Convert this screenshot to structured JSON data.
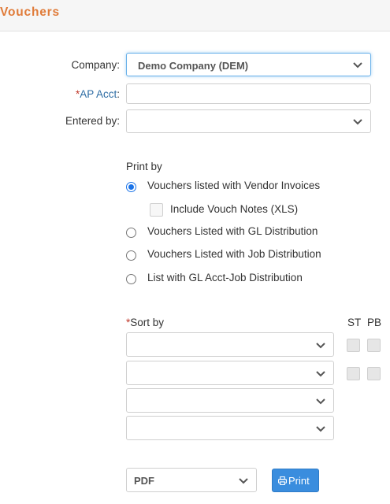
{
  "header": {
    "title": "Vouchers"
  },
  "form": {
    "company": {
      "label": "Company:",
      "value": "Demo Company (DEM)"
    },
    "ap_acct": {
      "required_marker": "*",
      "label": "AP Acct",
      "colon": ":",
      "value": ""
    },
    "entered_by": {
      "label": "Entered by:",
      "value": ""
    }
  },
  "print_by": {
    "label": "Print by",
    "options": [
      {
        "label": "Vouchers listed with Vendor Invoices",
        "selected": true
      },
      {
        "label": "Vouchers Listed with GL Distribution",
        "selected": false
      },
      {
        "label": "Vouchers Listed with Job Distribution",
        "selected": false
      },
      {
        "label": "List with GL Acct-Job Distribution",
        "selected": false
      }
    ],
    "include_notes": {
      "label": "Include Vouch Notes (XLS)",
      "checked": false
    }
  },
  "sort": {
    "required_marker": "*",
    "label": "Sort by",
    "st_header": "ST",
    "pb_header": "PB",
    "rows": [
      {
        "value": "",
        "st": false,
        "pb": false
      },
      {
        "value": "",
        "st": false,
        "pb": false
      },
      {
        "value": ""
      },
      {
        "value": ""
      }
    ]
  },
  "output": {
    "format": "PDF",
    "print_label": "Print"
  },
  "colors": {
    "accent_orange": "#e07b39",
    "required_red": "#c0392b",
    "link_blue": "#2e6da4",
    "radio_blue": "#1a73e8",
    "button_blue": "#3a8dde"
  },
  "icons": {
    "dropdown": "chevron-down-icon",
    "print": "printer-icon"
  }
}
